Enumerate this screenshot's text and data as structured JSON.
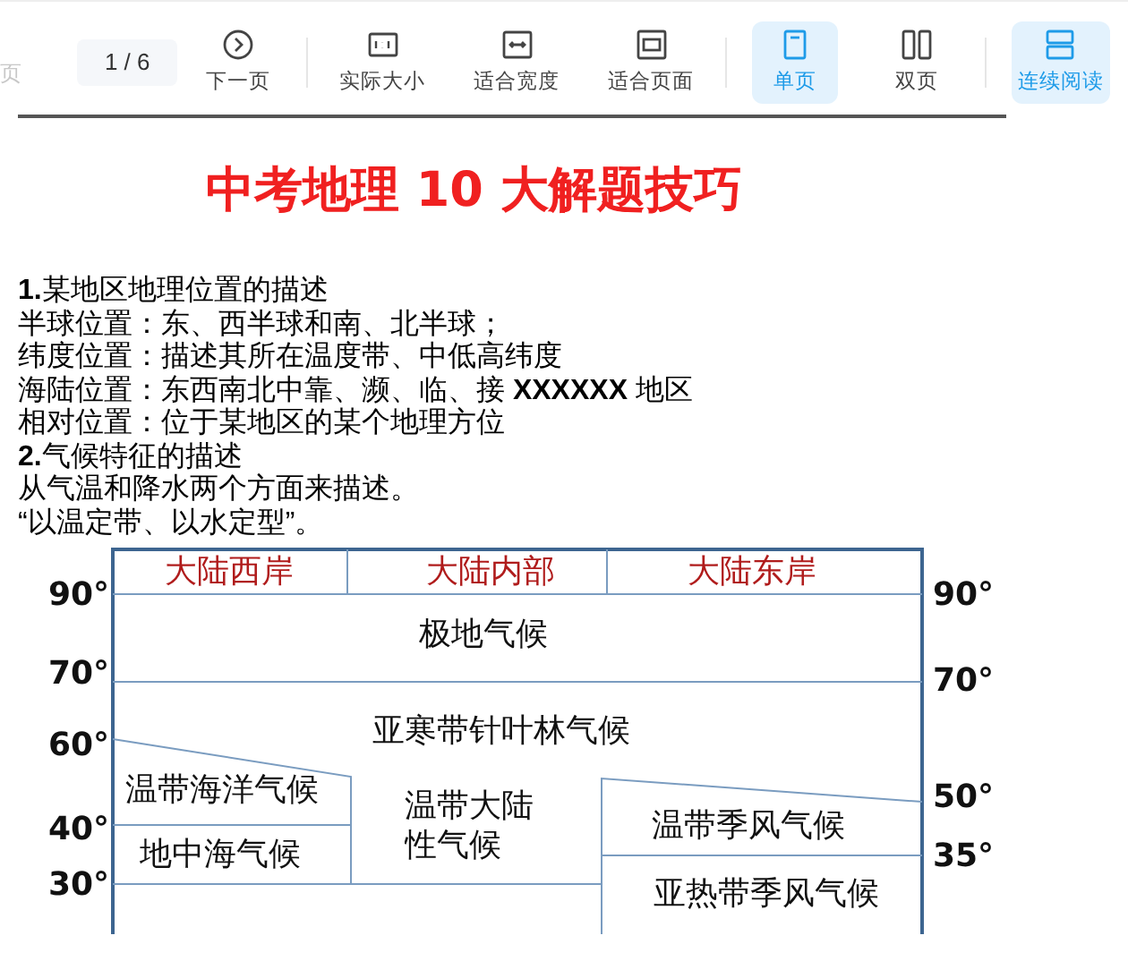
{
  "toolbar": {
    "prev": {
      "label": "页",
      "disabled": true
    },
    "page_field": "1 / 6",
    "buttons": [
      {
        "label": "下一页",
        "selected": false
      },
      {
        "label": "实际大小",
        "selected": false
      },
      {
        "label": "适合宽度",
        "selected": false
      },
      {
        "label": "适合页面",
        "selected": false
      },
      {
        "label": "单页",
        "selected": true
      },
      {
        "label": "双页",
        "selected": false
      },
      {
        "label": "连续阅读",
        "selected": true
      }
    ]
  },
  "document": {
    "title": "中考地理 10 大解题技巧",
    "lines": [
      "**1.**某地区地理位置的描述",
      "半球位置：东、西半球和南、北半球；",
      "纬度位置：描述其所在温度带、中低高纬度",
      "海陆位置：东西南北中靠、濒、临、接 **XXXXXX** 地区",
      "相对位置：位于某地区的某个地理方位",
      "**2.**气候特征的描述",
      "从气温和降水两个方面来描述。",
      "“以温定带、以水定型”。"
    ],
    "diagram": {
      "columns": [
        "大陆西岸",
        "大陆内部",
        "大陆东岸"
      ],
      "zones": [
        "极地气候",
        "亚寒带针叶林气候",
        "温带海洋气候",
        "地中海气候",
        "温带大陆性气候",
        "温带季风气候",
        "亚热带季风气候"
      ],
      "left_ticks": [
        "90°",
        "70°",
        "60°",
        "40°",
        "30°"
      ],
      "right_ticks": [
        "90°",
        "70°",
        "50°",
        "35°"
      ]
    }
  }
}
